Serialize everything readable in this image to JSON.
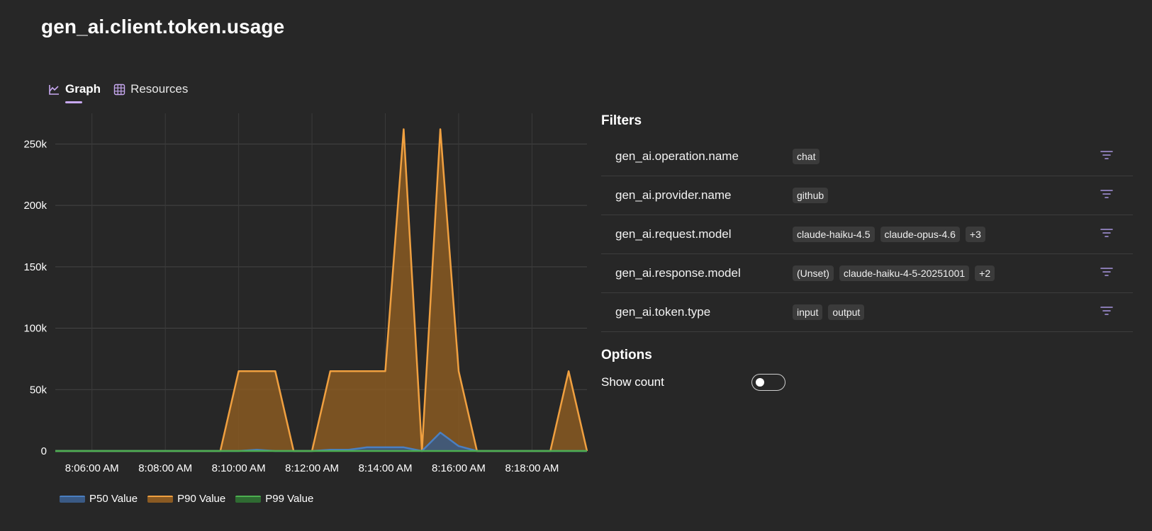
{
  "page": {
    "title": "gen_ai.client.token.usage"
  },
  "tabs": [
    {
      "label": "Graph",
      "icon": "chart-icon",
      "active": true
    },
    {
      "label": "Resources",
      "icon": "grid-icon",
      "active": false
    }
  ],
  "chart_data": {
    "type": "area",
    "x": [
      "8:05:00",
      "8:05:30",
      "8:06:00",
      "8:06:30",
      "8:07:00",
      "8:07:30",
      "8:08:00",
      "8:08:30",
      "8:09:00",
      "8:09:30",
      "8:10:00",
      "8:10:30",
      "8:11:00",
      "8:11:30",
      "8:12:00",
      "8:12:30",
      "8:13:00",
      "8:13:30",
      "8:14:00",
      "8:14:30",
      "8:15:00",
      "8:15:30",
      "8:16:00",
      "8:16:30",
      "8:17:00",
      "8:17:30",
      "8:18:00",
      "8:18:30",
      "8:19:00",
      "8:19:30"
    ],
    "xticks": [
      "8:06:00 AM",
      "8:08:00 AM",
      "8:10:00 AM",
      "8:12:00 AM",
      "8:14:00 AM",
      "8:16:00 AM",
      "8:18:00 AM"
    ],
    "yticks": [
      "0",
      "50k",
      "100k",
      "150k",
      "200k",
      "250k"
    ],
    "ylim": [
      0,
      275000
    ],
    "grid": true,
    "legend_position": "bottom-left",
    "series": [
      {
        "name": "P50 Value",
        "color": "#4a7fc1",
        "fill": "#3a5a85",
        "values": [
          0,
          0,
          0,
          0,
          0,
          0,
          0,
          0,
          0,
          0,
          0,
          1000,
          0,
          0,
          0,
          1000,
          1000,
          3000,
          3000,
          3000,
          0,
          15000,
          4000,
          0,
          0,
          0,
          0,
          0,
          0,
          0
        ]
      },
      {
        "name": "P90 Value",
        "color": "#f0a040",
        "fill": "#8a5a22",
        "values": [
          0,
          0,
          0,
          0,
          0,
          0,
          0,
          0,
          0,
          0,
          65000,
          65000,
          65000,
          0,
          0,
          65000,
          65000,
          65000,
          65000,
          262000,
          0,
          262000,
          65000,
          0,
          0,
          0,
          0,
          0,
          65000,
          0
        ]
      },
      {
        "name": "P99 Value",
        "color": "#4caf50",
        "fill": "#2f6b32",
        "values": [
          0,
          0,
          0,
          0,
          0,
          0,
          0,
          0,
          0,
          0,
          0,
          0,
          0,
          0,
          0,
          0,
          0,
          0,
          0,
          0,
          0,
          0,
          0,
          0,
          0,
          0,
          0,
          0,
          0,
          0
        ]
      }
    ]
  },
  "filters": {
    "title": "Filters",
    "rows": [
      {
        "name": "gen_ai.operation.name",
        "chips": [
          "chat"
        ]
      },
      {
        "name": "gen_ai.provider.name",
        "chips": [
          "github"
        ]
      },
      {
        "name": "gen_ai.request.model",
        "chips": [
          "claude-haiku-4.5",
          "claude-opus-4.6",
          "+3"
        ]
      },
      {
        "name": "gen_ai.response.model",
        "chips": [
          "(Unset)",
          "claude-haiku-4-5-20251001",
          "+2"
        ]
      },
      {
        "name": "gen_ai.token.type",
        "chips": [
          "input",
          "output"
        ]
      }
    ]
  },
  "options": {
    "title": "Options",
    "show_count_label": "Show count",
    "show_count": false
  },
  "colors": {
    "background": "#272727",
    "accent": "#c7a8f0",
    "filter_icon": "#a996e0"
  }
}
